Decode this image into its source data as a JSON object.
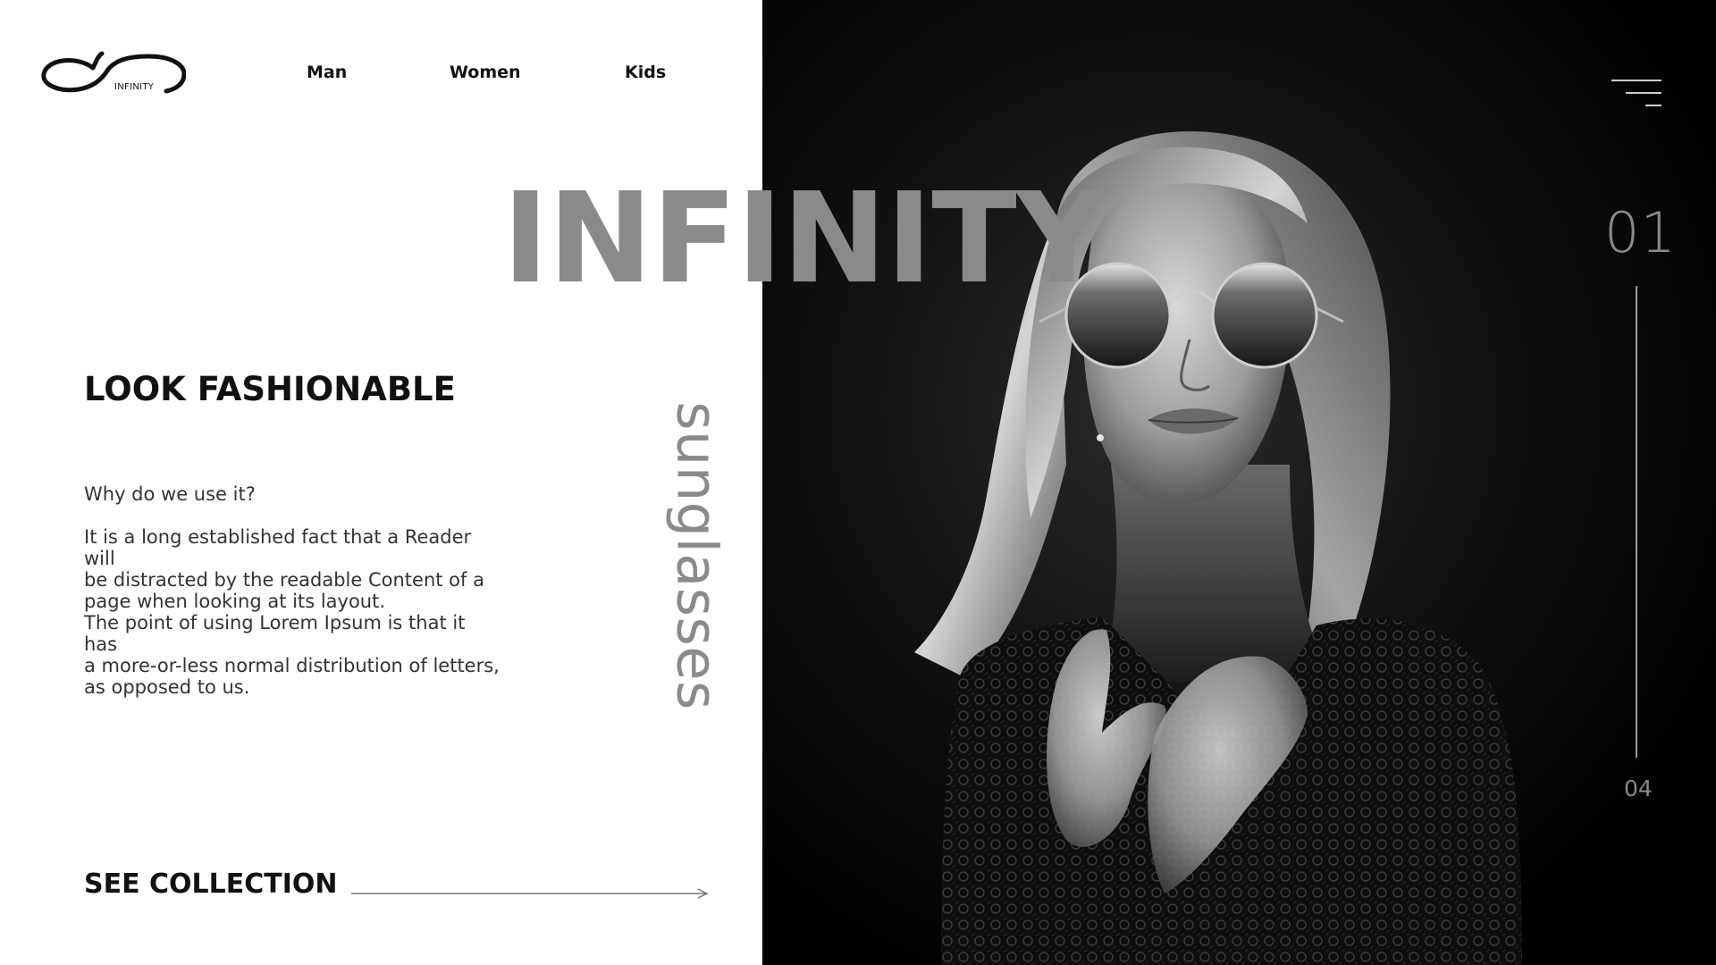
{
  "brand": {
    "logo_text": "INFINITY"
  },
  "nav": {
    "items": [
      {
        "label": "Man"
      },
      {
        "label": "Women"
      },
      {
        "label": "Kids"
      }
    ]
  },
  "hero": {
    "title": "INFINITY",
    "vertical_word": "sunglasses",
    "headline": "LOOK FASHIONABLE",
    "question": "Why do we use it?",
    "paragraph_lines": [
      "It is a long established fact that a Reader will",
      "be distracted by the readable Content of a",
      "page when looking at its layout.",
      "The point of using Lorem Ipsum is that it has",
      "a more-or-less normal distribution of letters,",
      "as opposed to us."
    ],
    "cta_label": "SEE COLLECTION"
  },
  "slider": {
    "current": "01",
    "total": "04"
  },
  "icons": {
    "logo": "infinity-logo-icon",
    "menu": "hamburger-menu-icon",
    "cta_arrow": "arrow-right-icon"
  },
  "colors": {
    "accent_gray": "#8a8a8a",
    "dark_panel": "#000000",
    "text_dark": "#111111",
    "body_text": "#333333"
  }
}
